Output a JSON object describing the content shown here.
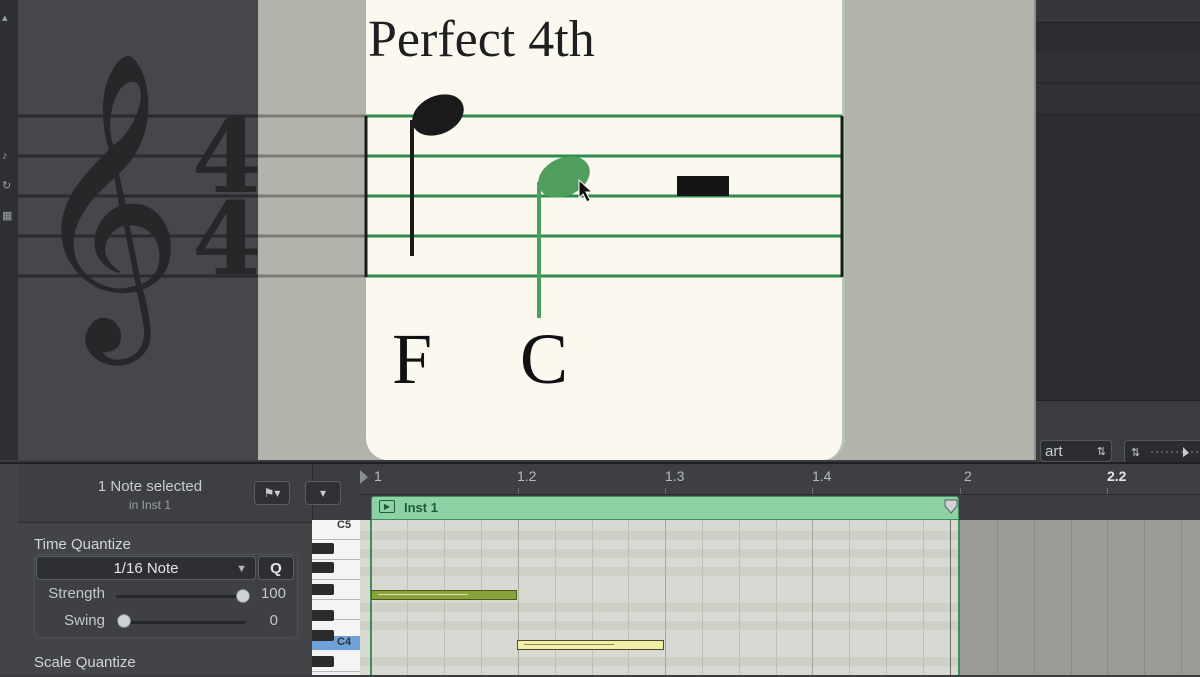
{
  "score": {
    "title": "Perfect 4th",
    "time_signature": {
      "top": "4",
      "bottom": "4"
    },
    "notes": [
      {
        "name": "F",
        "selected": false
      },
      {
        "name": "C",
        "selected": true
      }
    ],
    "colors": {
      "staff_active": "#2e8a4e",
      "note_selected": "#4f9e5e",
      "note_normal": "#1a1a1a",
      "card": "#fbf9ef"
    }
  },
  "inspector": {
    "selection_title": "1 Note selected",
    "selection_sub": "in Inst 1",
    "time_quantize": {
      "title": "Time Quantize",
      "value": "1/16 Note",
      "q_label": "Q",
      "strength_label": "Strength",
      "strength_value": "100",
      "swing_label": "Swing",
      "swing_value": "0"
    },
    "scale_quantize_title": "Scale Quantize"
  },
  "ruler": {
    "labels": [
      "1",
      "1.2",
      "1.3",
      "1.4",
      "2",
      "2.2"
    ]
  },
  "region": {
    "name": "Inst 1",
    "color": "#8ed1a4"
  },
  "keyboard": {
    "labels": [
      "C5",
      "C4"
    ]
  },
  "right_panel": {
    "part_label": "art"
  }
}
